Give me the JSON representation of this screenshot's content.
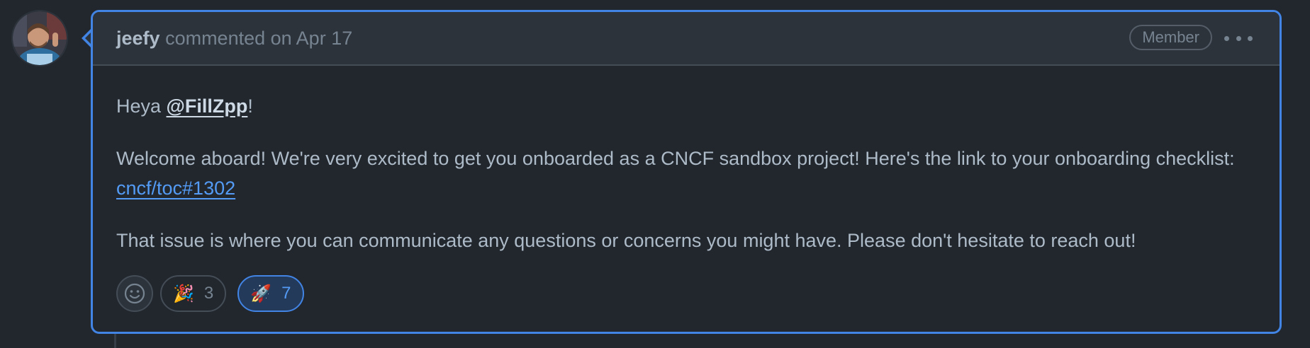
{
  "comment": {
    "author": "jeefy",
    "meta": "commented on Apr 17",
    "role_badge": "Member",
    "more_icon": "kebab-horizontal-icon",
    "body": {
      "greeting_prefix": "Heya ",
      "mention": "@FillZpp",
      "greeting_suffix": "!",
      "welcome_text": "Welcome aboard! We're very excited to get you onboarded as a CNCF sandbox project! Here's the link to your onboarding checklist: ",
      "checklist_link": "cncf/toc#1302",
      "closing_text": "That issue is where you can communicate any questions or concerns you might have. Please don't hesitate to reach out!"
    },
    "reactions": [
      {
        "emoji": "🎉",
        "icon": "party-popper-icon",
        "count": "3",
        "active": false
      },
      {
        "emoji": "🚀",
        "icon": "rocket-icon",
        "count": "7",
        "active": true
      }
    ],
    "add_reaction_icon": "smiley-icon"
  },
  "colors": {
    "background": "#22272e",
    "header_bg": "#2d333b",
    "accent_border": "#4184e4",
    "link": "#539bf5",
    "text": "#adbac7",
    "muted": "#768390"
  }
}
